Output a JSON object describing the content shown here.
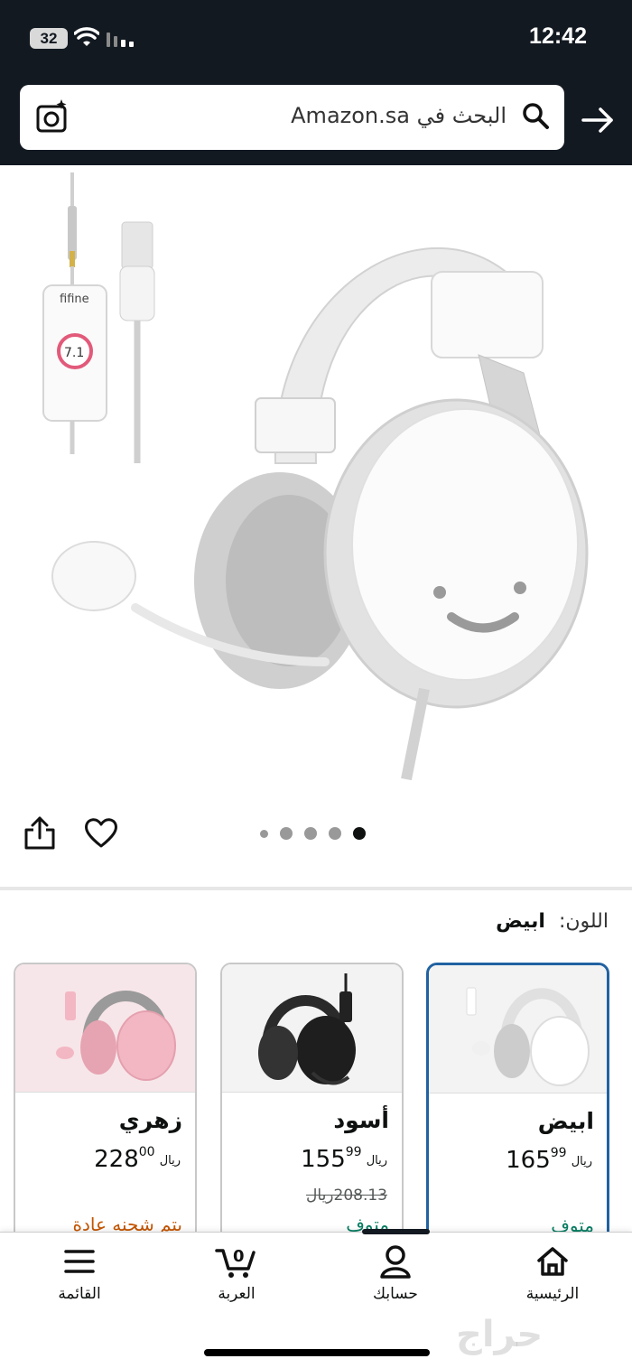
{
  "status": {
    "battery": "32",
    "time": "12:42"
  },
  "search": {
    "placeholder": "البحث في Amazon.sa"
  },
  "gallery": {
    "brand_mark": "fifine",
    "dial_label": "7.1",
    "page_count": 5,
    "active_page": 5
  },
  "color": {
    "label": "اللون:",
    "value": "ابيض"
  },
  "variants": [
    {
      "name": "ابيض",
      "price_main": "165",
      "price_fraction": "99",
      "currency": "ريال",
      "old_price": "",
      "availability": "متوف",
      "selected": true
    },
    {
      "name": "أسود",
      "price_main": "155",
      "price_fraction": "99",
      "currency": "ريال",
      "old_price": "208.13ريال",
      "availability": "متوف",
      "selected": false
    },
    {
      "name": "زهري",
      "price_main": "228",
      "price_fraction": "00",
      "currency": "ريال",
      "old_price": "",
      "availability": "يتم شحنه عادة",
      "selected": false
    }
  ],
  "bottom_nav": {
    "home": "الرئيسية",
    "account": "حسابك",
    "cart": "العربة",
    "cart_count": "0",
    "menu": "القائمة"
  },
  "watermark": "حراج",
  "colors": {
    "header_bg": "#131921",
    "selected_border": "#2162a1",
    "in_stock": "#067d62",
    "shipping": "#c45500"
  }
}
